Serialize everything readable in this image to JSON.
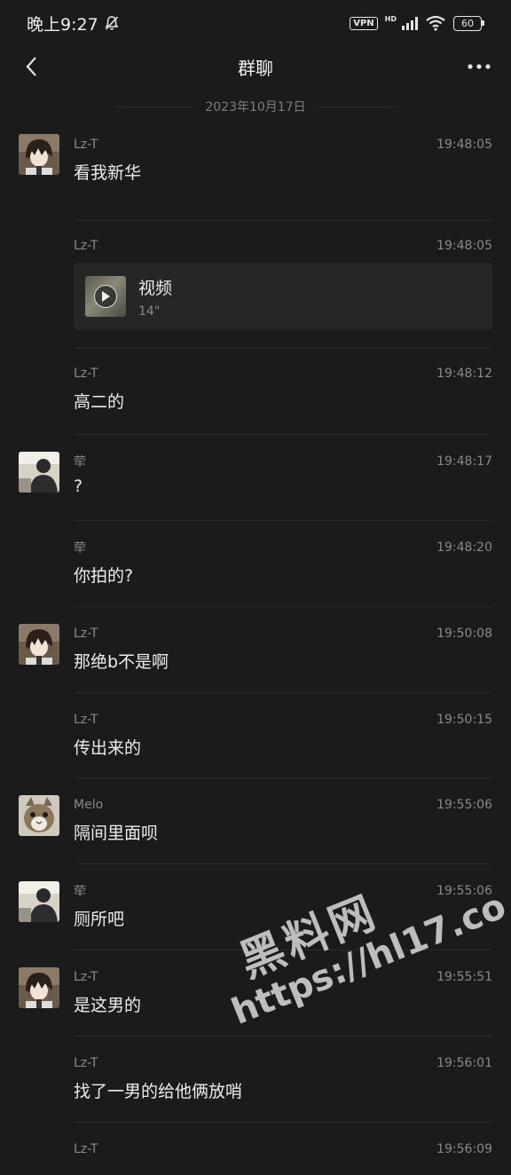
{
  "status_bar": {
    "time": "晚上9:27",
    "vpn": "VPN",
    "network": "HD",
    "battery": "60"
  },
  "nav": {
    "title": "群聊"
  },
  "date_separator": "2023年10月17日",
  "messages": [
    {
      "sender": "Lz-T",
      "time": "19:48:05",
      "text": "看我新华",
      "avatar": "anime-boy"
    },
    {
      "sender": "Lz-T",
      "time": "19:48:05",
      "video": {
        "title": "视频",
        "duration": "14\""
      }
    },
    {
      "sender": "Lz-T",
      "time": "19:48:12",
      "text": "高二的"
    },
    {
      "sender": "荦",
      "time": "19:48:17",
      "text": "?",
      "avatar": "person-photo"
    },
    {
      "sender": "荦",
      "time": "19:48:20",
      "text": "你拍的?"
    },
    {
      "sender": "Lz-T",
      "time": "19:50:08",
      "text": "那绝b不是啊",
      "avatar": "anime-boy"
    },
    {
      "sender": "Lz-T",
      "time": "19:50:15",
      "text": "传出来的"
    },
    {
      "sender": "Melo",
      "time": "19:55:06",
      "text": "隔间里面呗",
      "avatar": "cat"
    },
    {
      "sender": "荦",
      "time": "19:55:06",
      "text": "厕所吧",
      "avatar": "person-photo"
    },
    {
      "sender": "Lz-T",
      "time": "19:55:51",
      "text": "是这男的",
      "avatar": "anime-boy"
    },
    {
      "sender": "Lz-T",
      "time": "19:56:01",
      "text": "找了一男的给他俩放哨"
    },
    {
      "sender": "Lz-T",
      "time": "19:56:09",
      "text": ""
    }
  ],
  "watermark": {
    "brand": "黑料网",
    "url": "https://hl17.co"
  },
  "colors": {
    "background": "#1b1b1b",
    "card": "#262626",
    "text": "#ececec",
    "muted": "#8a8a8a"
  }
}
